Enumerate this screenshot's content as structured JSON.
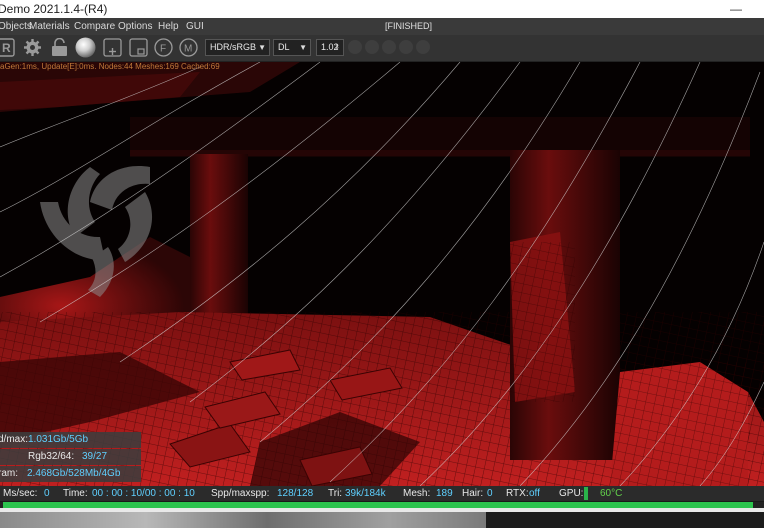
{
  "window": {
    "title": "Demo 2021.1.4-(R4)",
    "minimize_glyph": "—"
  },
  "menubar": {
    "items": [
      "Objects",
      "Materials",
      "Compare",
      "Options",
      "Help",
      "GUI"
    ],
    "render_status": "[FINISHED]"
  },
  "toolbar": {
    "icons": [
      "record-icon",
      "settings-gear-icon",
      "lock-icon",
      "sphere-icon",
      "add-node-icon",
      "node-icon",
      "f-icon",
      "m-icon"
    ],
    "icon_letters": {
      "f": "F",
      "m": "M"
    },
    "colorspace": "HDR/sRGB",
    "kernel": "DL",
    "gamma": "1.02"
  },
  "overlay": {
    "info_line": "aGen:1ms, Update[E]:0ms. Nodes:44 Meshes:169 Cached:69"
  },
  "stats": [
    {
      "label": "d/max:",
      "value": "1.031Gb/5Gb"
    },
    {
      "label": "Rgb32/64:",
      "value": "39/27"
    },
    {
      "label": "ram:",
      "value": "2.468Gb/528Mb/4Gb"
    }
  ],
  "statusbar": {
    "ms_label": "Ms/sec:",
    "ms_value": "0",
    "time_label": "Time:",
    "time_value": "00 : 00 : 10/00 : 00 : 10",
    "spp_label": "Spp/maxspp:",
    "spp_value": "128/128",
    "tri_label": "Tri:",
    "tri_value": "39k/184k",
    "mesh_label": "Mesh:",
    "mesh_value": "189",
    "hair_label": "Hair:",
    "hair_value": "0",
    "rtx_label": "RTX:",
    "rtx_value": "off",
    "gpu_label": "GPU:",
    "gpu_temp": "60°C"
  },
  "render_progress": 0.99,
  "colors": {
    "accent_blue": "#5fd0ff",
    "progress_green": "#2cc44e",
    "render_red": "#b01818"
  }
}
